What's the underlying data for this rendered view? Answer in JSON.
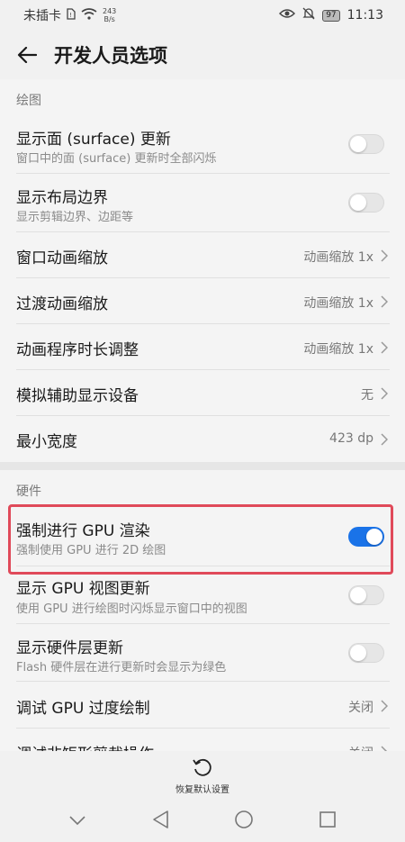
{
  "status_bar": {
    "carrier": "未插卡",
    "net_speed_value": "243",
    "net_speed_unit": "B/s",
    "battery": "97",
    "time": "11:13"
  },
  "header": {
    "title": "开发人员选项"
  },
  "drawing": {
    "label": "绘图",
    "rows": [
      {
        "title": "显示面 (surface) 更新",
        "subtitle": "窗口中的面 (surface) 更新时全部闪烁",
        "toggle": false
      },
      {
        "title": "显示布局边界",
        "subtitle": "显示剪辑边界、边距等",
        "toggle": false
      },
      {
        "title": "窗口动画缩放",
        "value": "动画缩放 1x"
      },
      {
        "title": "过渡动画缩放",
        "value": "动画缩放 1x"
      },
      {
        "title": "动画程序时长调整",
        "value": "动画缩放 1x"
      },
      {
        "title": "模拟辅助显示设备",
        "value": "无"
      },
      {
        "title": "最小宽度",
        "value": "423 dp"
      }
    ]
  },
  "hardware": {
    "label": "硬件",
    "rows": [
      {
        "title": "强制进行 GPU 渲染",
        "subtitle": "强制使用 GPU 进行 2D 绘图",
        "toggle": true
      },
      {
        "title": "显示 GPU 视图更新",
        "subtitle": "使用 GPU 进行绘图时闪烁显示窗口中的视图",
        "toggle": false
      },
      {
        "title": "显示硬件层更新",
        "subtitle": "Flash 硬件层在进行更新时会显示为绿色",
        "toggle": false
      },
      {
        "title": "调试 GPU 过度绘制",
        "value": "关闭"
      },
      {
        "title": "调试非矩形剪裁操作",
        "value": "关闭"
      }
    ]
  },
  "bottom": {
    "reset_label": "恢复默认设置"
  },
  "colors": {
    "accent": "#1a73e8",
    "highlight": "#e04a5a"
  }
}
